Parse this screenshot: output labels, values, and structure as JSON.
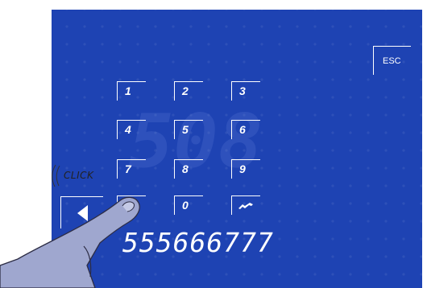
{
  "screen": {
    "background": "#1e43b3",
    "ghost_digits": "508"
  },
  "esc_button": {
    "label": "ESC"
  },
  "keypad": {
    "keys": [
      {
        "label": "1"
      },
      {
        "label": "2"
      },
      {
        "label": "3"
      },
      {
        "label": "4"
      },
      {
        "label": "5"
      },
      {
        "label": "6"
      },
      {
        "label": "7"
      },
      {
        "label": "8"
      },
      {
        "label": "9"
      },
      {
        "label": "",
        "icon": "phone-call-icon"
      },
      {
        "label": "0"
      },
      {
        "label": "",
        "icon": "hang-up-icon"
      }
    ]
  },
  "back_button": {
    "icon": "left-arrow-icon"
  },
  "display": {
    "number": "555666777"
  },
  "annotation": {
    "click_label": "CLICK",
    "icon": "pointing-hand-icon"
  }
}
